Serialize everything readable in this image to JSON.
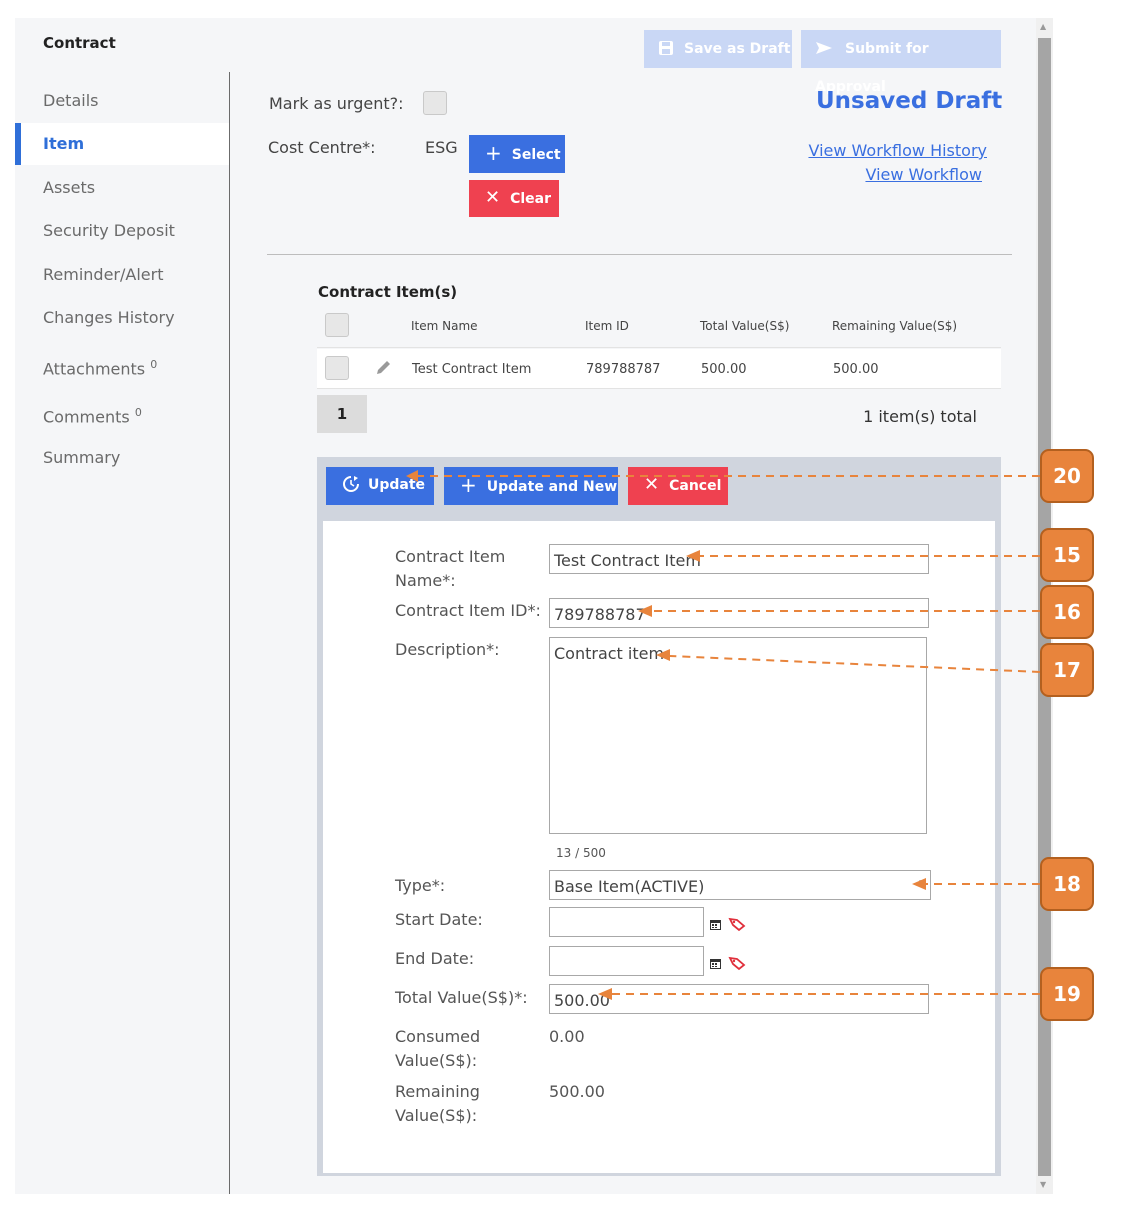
{
  "app": {
    "title": "Contract",
    "save_draft_label": "Save as Draft",
    "submit_label": "Submit for Approval"
  },
  "sidebar": {
    "items": [
      {
        "label": "Details"
      },
      {
        "label": "Item"
      },
      {
        "label": "Assets"
      },
      {
        "label": "Security Deposit"
      },
      {
        "label": "Reminder/Alert"
      },
      {
        "label": "Changes History"
      },
      {
        "label": "Attachments",
        "count": "0"
      },
      {
        "label": "Comments",
        "count": "0"
      },
      {
        "label": "Summary"
      }
    ]
  },
  "header": {
    "urgent_label": "Mark as urgent?:",
    "cost_centre_label": "Cost Centre*:",
    "cost_centre_value": "ESG",
    "select_label": "Select",
    "clear_label": "Clear",
    "status": "Unsaved Draft",
    "workflow_history_link": "View Workflow History",
    "workflow_link": "View Workflow"
  },
  "items_table": {
    "title": "Contract Item(s)",
    "columns": [
      "Item Name",
      "Item ID",
      "Total Value(S$)",
      "Remaining Value(S$)"
    ],
    "rows": [
      {
        "name": "Test Contract Item",
        "id": "789788787",
        "total": "500.00",
        "remaining": "500.00"
      }
    ],
    "page": "1",
    "total_text": "1 item(s) total"
  },
  "editor": {
    "update_label": "Update",
    "update_new_label": "Update and New",
    "cancel_label": "Cancel",
    "name_label": "Contract Item Name*:",
    "name_value": "Test Contract Item",
    "id_label": "Contract Item ID*:",
    "id_value": "789788787",
    "desc_label": "Description*:",
    "desc_value": "Contract item",
    "char_count": "13 / 500",
    "type_label": "Type*:",
    "type_value": "Base Item(ACTIVE)",
    "start_label": "Start Date:",
    "end_label": "End Date:",
    "total_label": "Total Value(S$)*:",
    "total_value": "500.00",
    "consumed_label": "Consumed Value(S$):",
    "consumed_value": "0.00",
    "remaining_label": "Remaining Value(S$):",
    "remaining_value": "500.00"
  },
  "callouts": [
    "20",
    "15",
    "16",
    "17",
    "18",
    "19"
  ],
  "colors": {
    "accent": "#3a6fe0",
    "danger": "#ef4150",
    "callout": "#e8843c"
  }
}
